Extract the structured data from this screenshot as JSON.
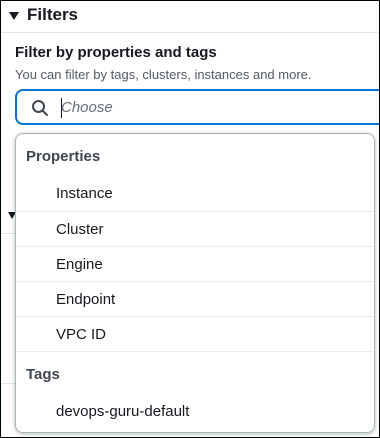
{
  "section": {
    "title": "Filters"
  },
  "filter": {
    "label": "Filter by properties and tags",
    "description": "You can filter by tags, clusters, instances and more.",
    "placeholder": "Choose"
  },
  "dropdown": {
    "groups": [
      {
        "label": "Properties",
        "options": [
          "Instance",
          "Cluster",
          "Engine",
          "Endpoint",
          "VPC ID"
        ]
      },
      {
        "label": "Tags",
        "options": [
          "devops-guru-default"
        ]
      }
    ]
  },
  "icons": {
    "caret": "caret-down-icon",
    "search": "search-icon"
  },
  "colors": {
    "focus_border": "#0972d3",
    "text": "#16191f",
    "muted_text": "#545b64",
    "group_label": "#414750"
  }
}
